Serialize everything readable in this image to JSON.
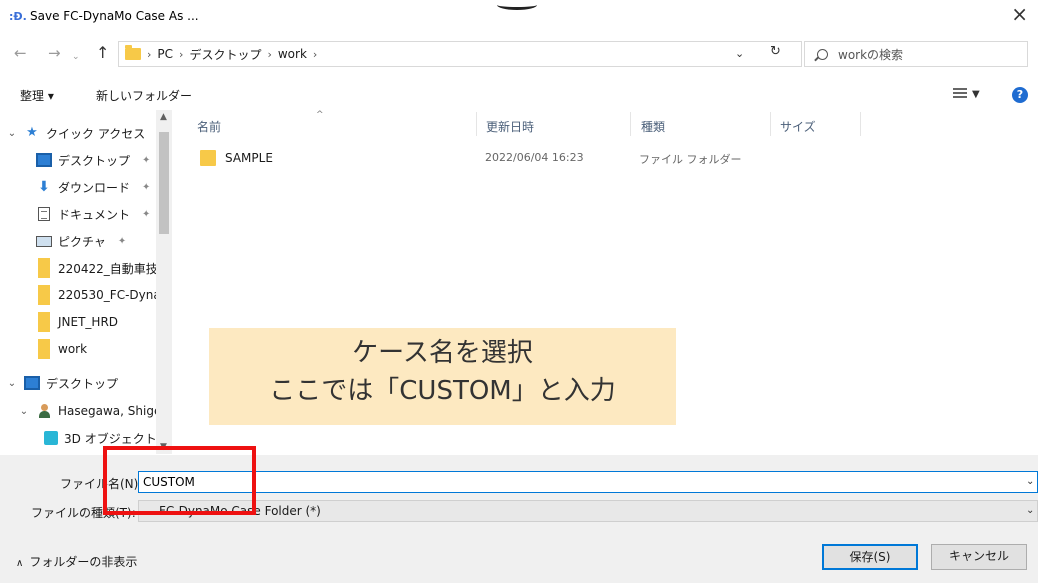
{
  "window": {
    "title": "Save FC-DynaMo Case As ...",
    "app_icon": ":Ð."
  },
  "address": {
    "breadcrumbs": [
      "PC",
      "デスクトップ",
      "work"
    ],
    "search_placeholder": "workの検索"
  },
  "toolbar": {
    "organize": "整理 ▾",
    "new_folder": "新しいフォルダー"
  },
  "nav_pane": {
    "items": [
      {
        "label": "クイック アクセス"
      },
      {
        "label": "デスクトップ"
      },
      {
        "label": "ダウンロード"
      },
      {
        "label": "ドキュメント"
      },
      {
        "label": "ピクチャ"
      },
      {
        "label": "220422_自動車技"
      },
      {
        "label": "220530_FC-Dyna"
      },
      {
        "label": "JNET_HRD"
      },
      {
        "label": "work"
      },
      {
        "label": "デスクトップ"
      },
      {
        "label": "Hasegawa, Shige"
      },
      {
        "label": "3D オブジェクト"
      }
    ]
  },
  "file_list": {
    "columns": [
      "名前",
      "更新日時",
      "種類",
      "サイズ"
    ],
    "rows": [
      {
        "name": "SAMPLE",
        "modified": "2022/06/04 16:23",
        "type": "ファイル フォルダー",
        "size": ""
      }
    ]
  },
  "bottom": {
    "filename_label": "ファイル名(N):",
    "filename_value": "CUSTOM",
    "filetype_label": "ファイルの種類(T):",
    "filetype_value": "FC-DynaMo Case Folder (*)",
    "hide_folders": "フォルダーの非表示",
    "save_button": "保存(S)",
    "cancel_button": "キャンセル"
  },
  "annotation": {
    "line1": "ケース名を選択",
    "line2": "ここでは「CUSTOM」と入力"
  },
  "colors": {
    "accent": "#0078d7",
    "folder": "#f7c948",
    "callout_bg": "#fde9c1",
    "highlight": "#ee1111"
  }
}
